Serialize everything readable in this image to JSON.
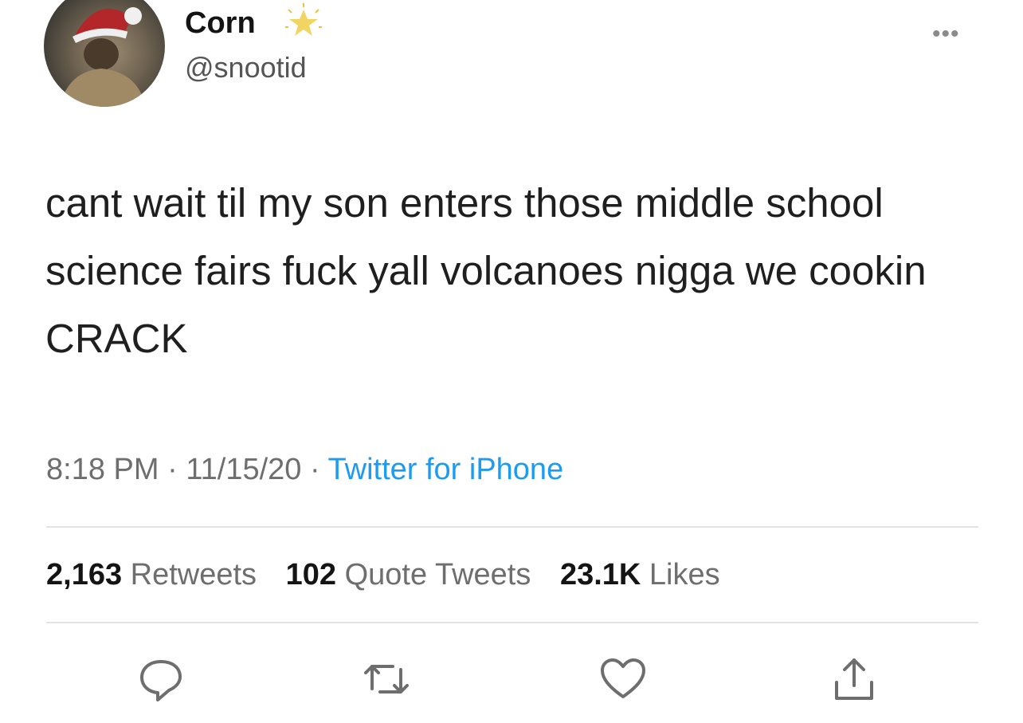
{
  "author": {
    "display_name": "Corn",
    "handle": "@snootid",
    "badge_icon": "star-icon"
  },
  "tweet": {
    "text": "cant wait til my son enters those middle school science fairs fuck yall volcanoes nigga we cookin CRACK",
    "time": "8:18 PM",
    "date": "11/15/20",
    "separator": "·",
    "source": "Twitter for iPhone"
  },
  "stats": {
    "retweets_count": "2,163",
    "retweets_label": "Retweets",
    "quote_count": "102",
    "quote_label": "Quote Tweets",
    "likes_count": "23.1K",
    "likes_label": "Likes"
  },
  "actions": {
    "reply_icon": "reply-icon",
    "retweet_icon": "retweet-icon",
    "like_icon": "heart-icon",
    "share_icon": "share-icon",
    "more_icon": "more-icon",
    "more_glyph": "•••"
  },
  "colors": {
    "link": "#1d9bf0",
    "secondary_text": "#6e6e6e",
    "icon": "#6e6e6e"
  }
}
